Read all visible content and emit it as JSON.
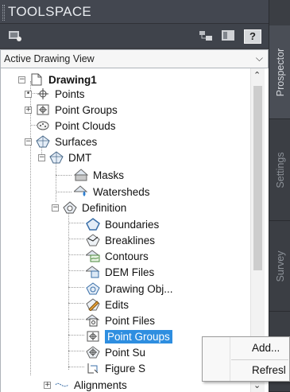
{
  "window": {
    "title": "TOOLSPACE"
  },
  "toolbar": {
    "help_label": "?"
  },
  "view_selector": {
    "value": "Active Drawing View"
  },
  "tree": {
    "drawing": "Drawing1",
    "points": "Points",
    "point_groups": "Point Groups",
    "point_clouds": "Point Clouds",
    "surfaces": "Surfaces",
    "dmt": "DMT",
    "masks": "Masks",
    "watersheds": "Watersheds",
    "definition": "Definition",
    "boundaries": "Boundaries",
    "breaklines": "Breaklines",
    "contours": "Contours",
    "dem_files": "DEM Files",
    "drawing_objects": "Drawing Obj...",
    "edits": "Edits",
    "point_files": "Point Files",
    "def_point_groups": "Point Groups",
    "point_survey": "Point Su",
    "figure_survey": "Figure S",
    "alignments": "Alignments"
  },
  "side_tabs": {
    "prospector": "Prospector",
    "settings": "Settings",
    "survey": "Survey"
  },
  "context_menu": {
    "add": "Add...",
    "refresh": "Refresl"
  }
}
